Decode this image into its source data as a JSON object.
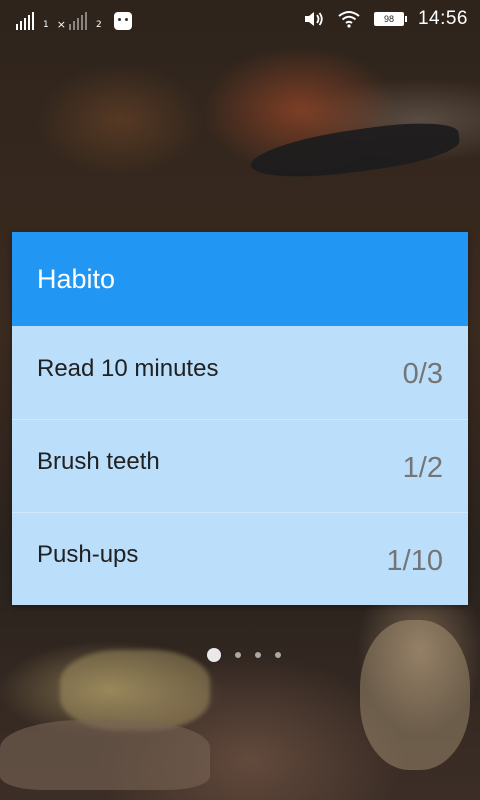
{
  "status_bar": {
    "sim1_label": "1",
    "sim2_x": "×",
    "sim2_label": "2",
    "battery_level": "98",
    "time": "14:56",
    "icons": [
      "signal-icon",
      "signal-icon",
      "bot-icon",
      "volume-icon",
      "wifi-icon",
      "battery-icon"
    ]
  },
  "widget": {
    "title": "Habito",
    "accent_color": "#2196f3",
    "list_background": "#bbdefb",
    "habits": [
      {
        "name": "Read 10 minutes",
        "count": "0/3"
      },
      {
        "name": "Brush teeth",
        "count": "1/2"
      },
      {
        "name": "Push-ups",
        "count": "1/10"
      }
    ]
  },
  "page_indicator": {
    "pages": 4,
    "active": 1
  }
}
